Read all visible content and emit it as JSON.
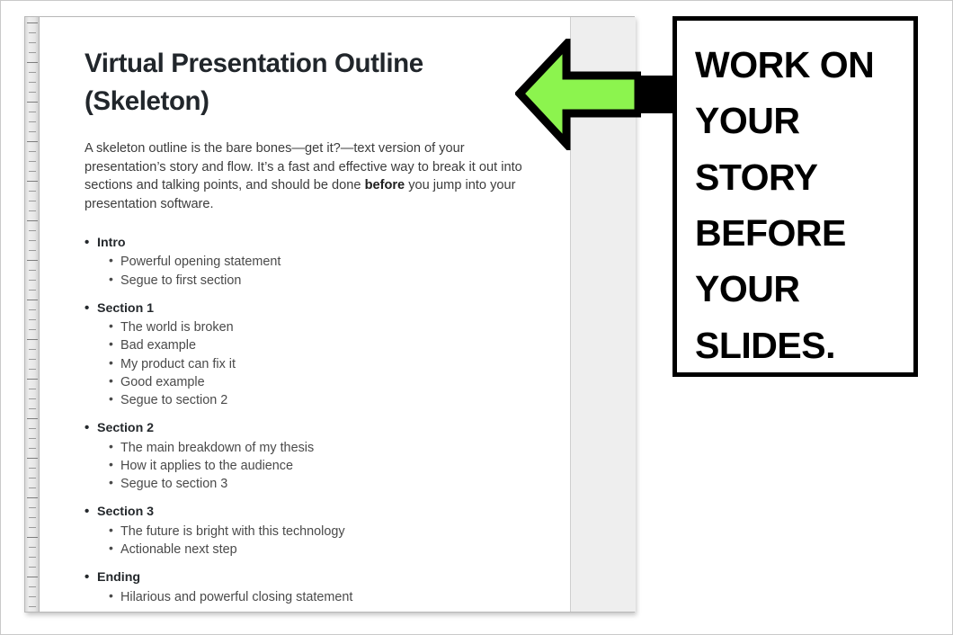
{
  "document": {
    "title": "Virtual Presentation Outline (Skeleton)",
    "paragraph": {
      "part1": "A skeleton outline is the bare bones—get it?—text version of your presentation’s story and flow. It’s a fast and effective way to break it out into sections and talking points, and should be done ",
      "emphasis": "before",
      "part2": " you jump into your presentation software."
    },
    "outline": [
      {
        "heading": "Intro",
        "items": [
          "Powerful opening statement",
          "Segue to first section"
        ]
      },
      {
        "heading": "Section 1",
        "items": [
          "The world is broken",
          "Bad example",
          "My product can fix it",
          "Good example",
          "Segue to section 2"
        ]
      },
      {
        "heading": "Section 2",
        "items": [
          "The main breakdown of my thesis",
          "How it applies to the audience",
          "Segue to section 3"
        ]
      },
      {
        "heading": "Section 3",
        "items": [
          "The future is bright with this technology",
          "Actionable next step"
        ]
      },
      {
        "heading": "Ending",
        "items": [
          "Hilarious and powerful closing statement"
        ]
      }
    ]
  },
  "annotation": {
    "arrow_icon": "left-arrow-icon",
    "callout_text": "WORK ON YOUR STORY BEFORE YOUR SLIDES."
  },
  "colors": {
    "arrow_fill": "#8cf44e",
    "arrow_stroke": "#000000",
    "connector": "#000000",
    "callout_border": "#000000",
    "page_background": "#ffffff",
    "gray_panel": "#eeeeee",
    "heading_text": "#21262b",
    "body_text": "#3c3c3c",
    "sub_bullet_text": "#4a4a4a"
  }
}
